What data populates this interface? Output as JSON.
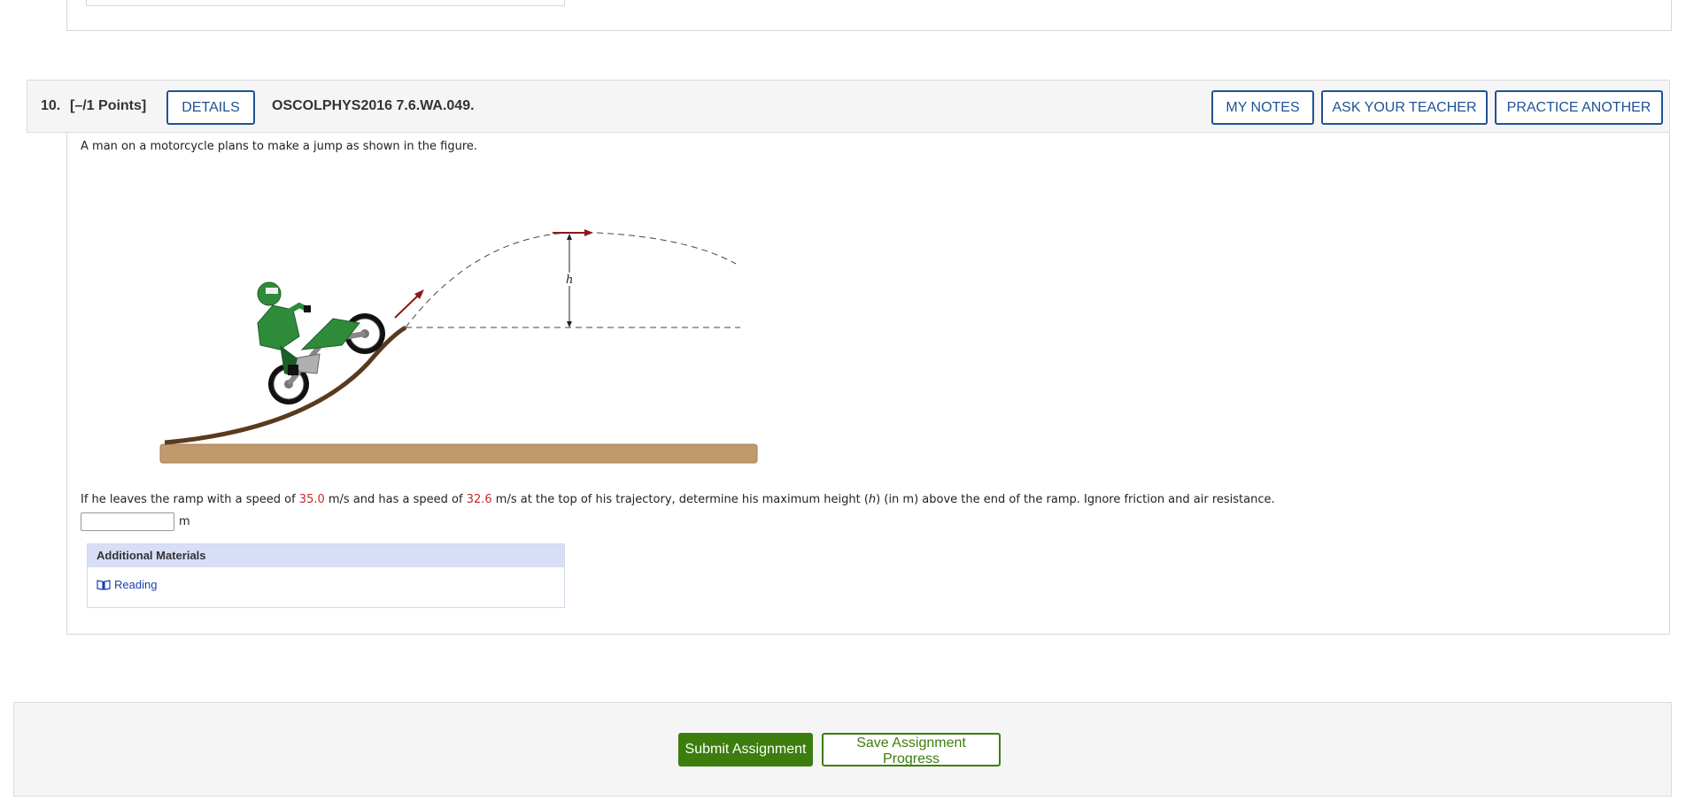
{
  "question": {
    "number": "10.",
    "points": "[–/1 Points]",
    "details_label": "DETAILS",
    "code": "OSCOLPHYS2016 7.6.WA.049.",
    "my_notes_label": "MY NOTES",
    "ask_teacher_label": "ASK YOUR TEACHER",
    "practice_label": "PRACTICE ANOTHER",
    "intro": "A man on a motorcycle plans to make a jump as shown in the figure.",
    "figure_label_h": "h",
    "prompt_1": "If he leaves the ramp with a speed of ",
    "speed_initial": "35.0",
    "prompt_2": " m/s and has a speed of ",
    "speed_top": "32.6",
    "prompt_3": " m/s at the top of his trajectory, determine his maximum height (",
    "prompt_h": "h",
    "prompt_4": ") (in m) above the end of the ramp. Ignore friction and air resistance.",
    "answer_value": "",
    "answer_unit": "m"
  },
  "materials": {
    "heading": "Additional Materials",
    "link_label": "Reading"
  },
  "footer": {
    "submit_label": "Submit Assignment",
    "save_label": "Save Assignment Progress"
  },
  "colors": {
    "accent_blue": "#215294",
    "submit_green": "#3c7d0e",
    "value_red": "#c62828"
  }
}
